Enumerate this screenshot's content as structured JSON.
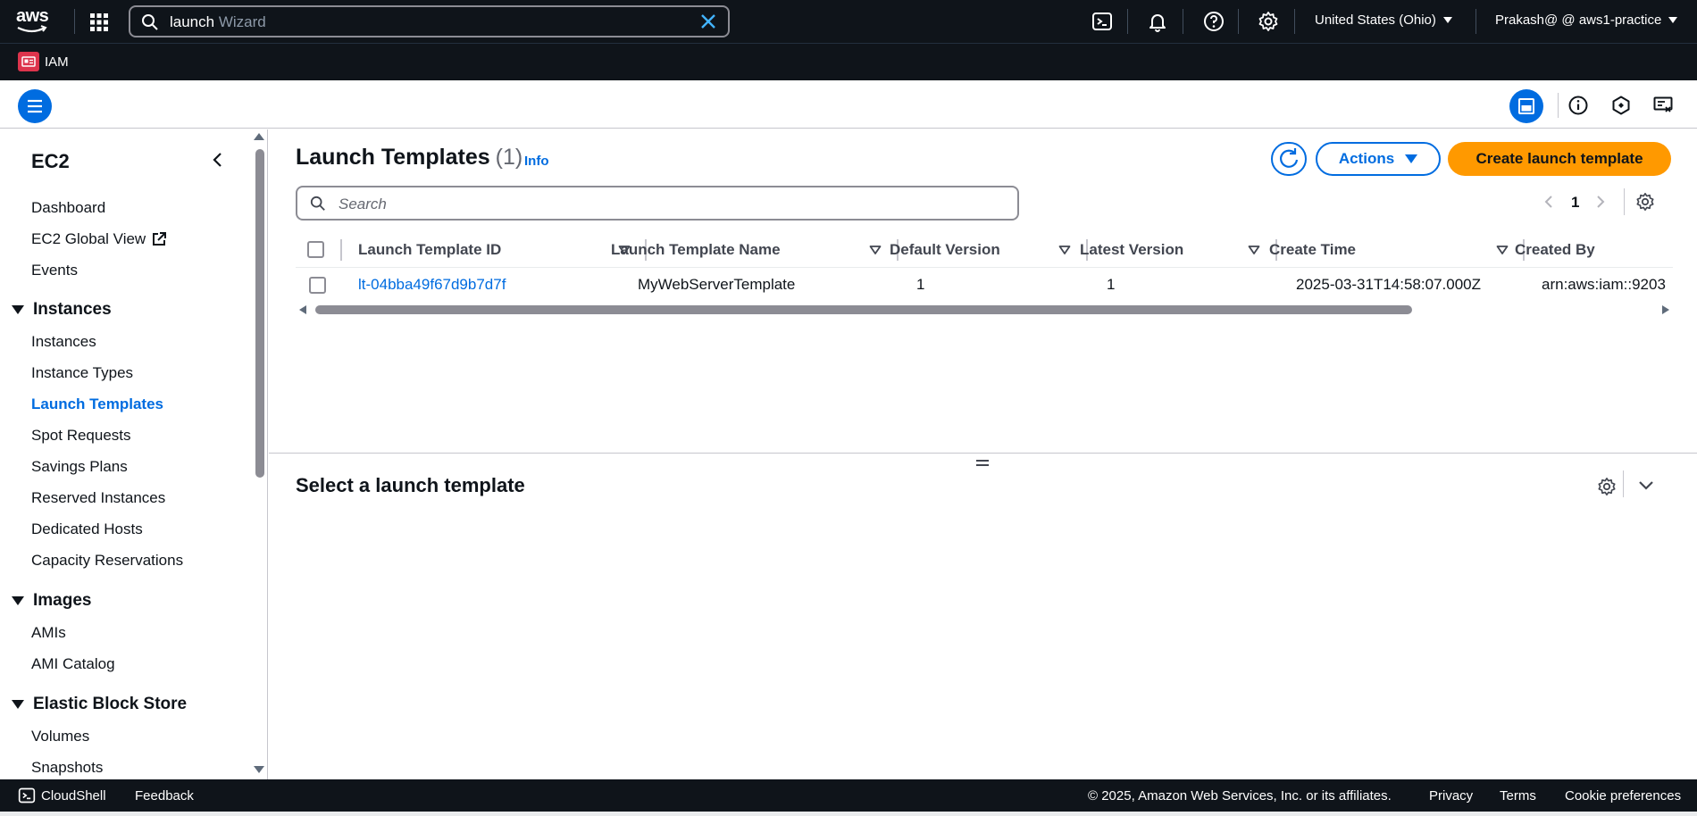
{
  "topnav": {
    "logo": "aws",
    "search_query": "launch",
    "search_hint": " Wizard",
    "region": "United States (Ohio)",
    "account": "Prakash@ @ aws1-practice"
  },
  "service_bar": {
    "service": "IAM"
  },
  "sidebar": {
    "title": "EC2",
    "top_links": [
      "Dashboard",
      "EC2 Global View",
      "Events"
    ],
    "sections": [
      {
        "title": "Instances",
        "items": [
          "Instances",
          "Instance Types",
          "Launch Templates",
          "Spot Requests",
          "Savings Plans",
          "Reserved Instances",
          "Dedicated Hosts",
          "Capacity Reservations"
        ]
      },
      {
        "title": "Images",
        "items": [
          "AMIs",
          "AMI Catalog"
        ]
      },
      {
        "title": "Elastic Block Store",
        "items": [
          "Volumes",
          "Snapshots"
        ]
      }
    ],
    "active_item": "Launch Templates"
  },
  "main": {
    "title": "Launch Templates",
    "count": "(1)",
    "info": "Info",
    "actions_label": "Actions",
    "create_label": "Create launch template",
    "search_placeholder": "Search",
    "page": "1",
    "table": {
      "columns": [
        "Launch Template ID",
        "Launch Template Name",
        "Default Version",
        "Latest Version",
        "Create Time",
        "Created By"
      ],
      "rows": [
        [
          "lt-04bba49f67d9b7d7f",
          "MyWebServerTemplate",
          "1",
          "1",
          "2025-03-31T14:58:07.000Z",
          "arn:aws:iam::9203"
        ]
      ]
    },
    "detail_title": "Select a launch template"
  },
  "footer": {
    "cloudshell": "CloudShell",
    "feedback": "Feedback",
    "copyright": "© 2025, Amazon Web Services, Inc. or its affiliates.",
    "privacy": "Privacy",
    "terms": "Terms",
    "cookies": "Cookie preferences"
  },
  "colors": {
    "nav_bg": "#0f141a",
    "accent": "#006ce0",
    "primary_button": "#ff9900",
    "iam_badge": "#dd344c"
  }
}
